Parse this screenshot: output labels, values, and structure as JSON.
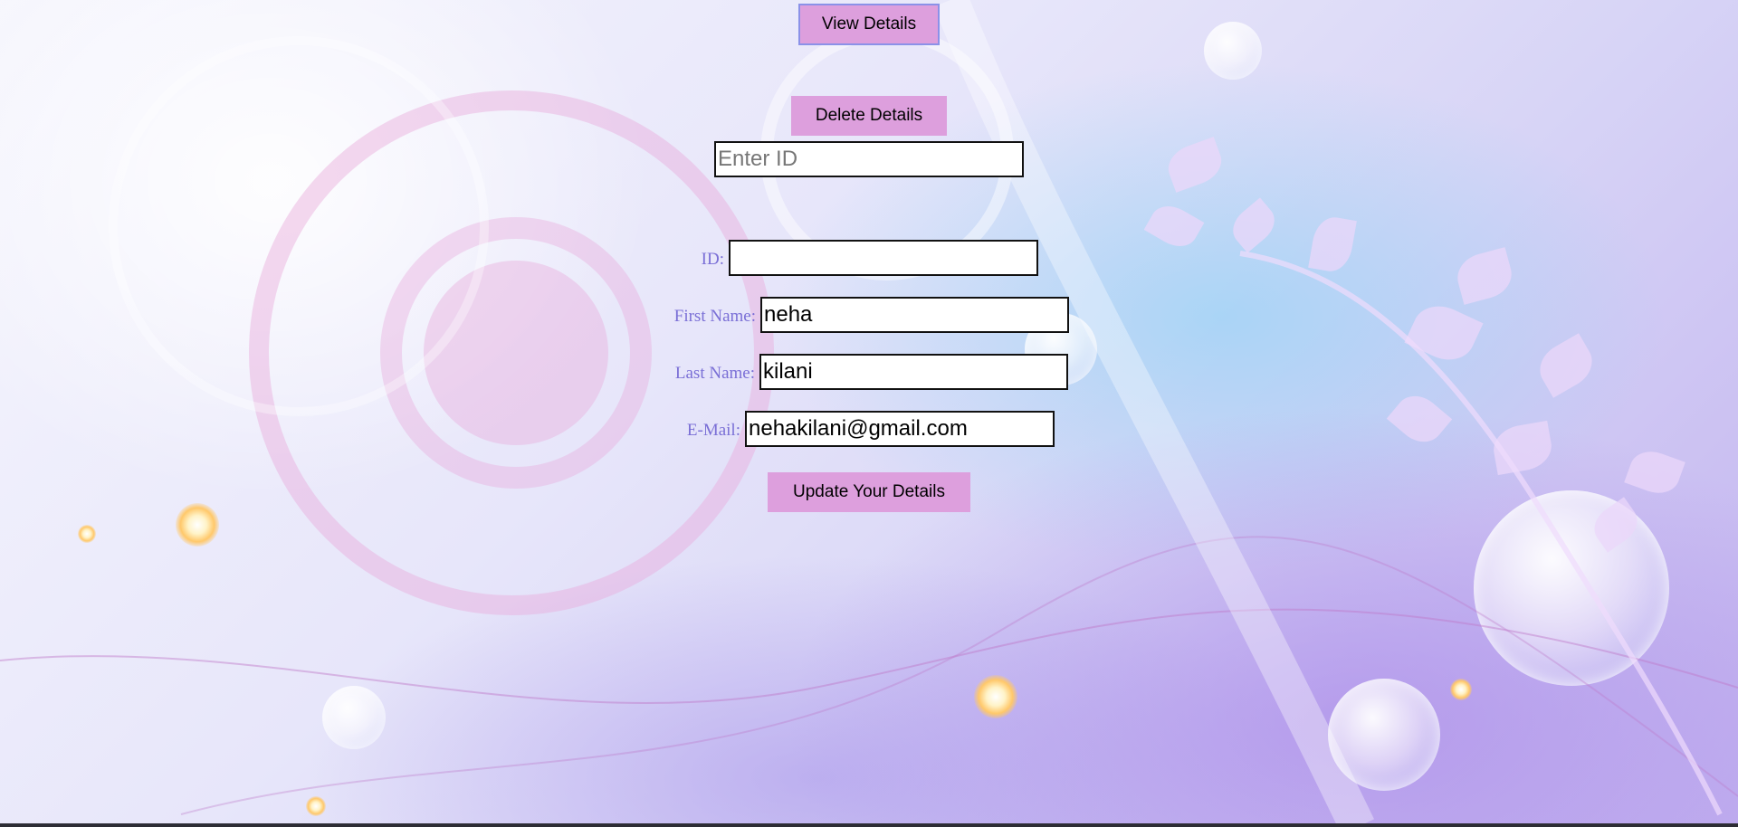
{
  "actions": {
    "view_label": "View Details",
    "delete_label": "Delete Details",
    "update_label": "Update Your Details"
  },
  "delete_form": {
    "id_placeholder": "Enter ID",
    "id_value": ""
  },
  "update_form": {
    "id_label": "ID:",
    "id_value": "",
    "first_name_label": "First Name:",
    "first_name_value": "neha",
    "last_name_label": "Last Name:",
    "last_name_value": "kilani",
    "email_label": "E-Mail:",
    "email_value": "nehakilani@gmail.com"
  },
  "theme": {
    "button_color": "#dd9fdd",
    "label_color": "#7a6fd6",
    "view_button_border": "#8b91e8"
  }
}
